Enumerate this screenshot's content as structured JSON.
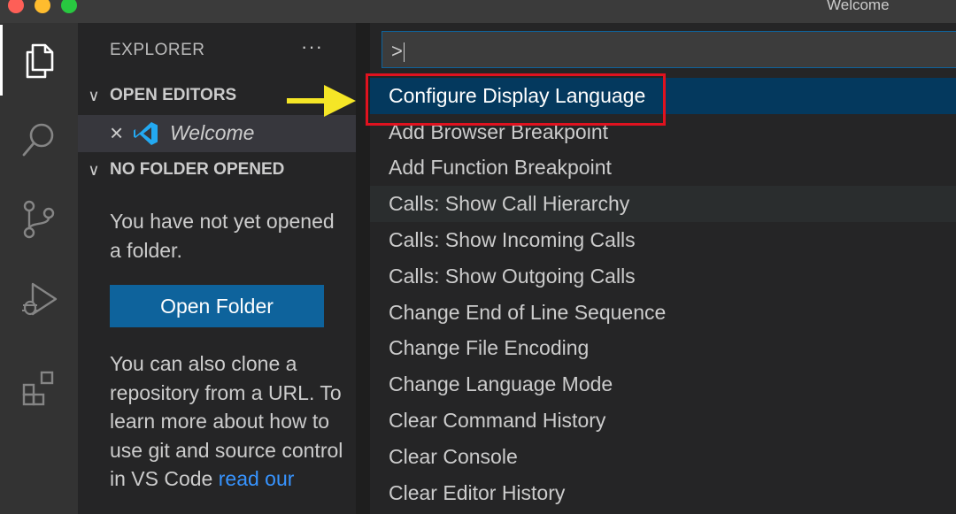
{
  "window": {
    "title": "Welcome"
  },
  "activity_bar": {
    "items": [
      {
        "icon": "explorer-icon",
        "active": true
      },
      {
        "icon": "search-icon",
        "active": false
      },
      {
        "icon": "source-control-icon",
        "active": false
      },
      {
        "icon": "run-debug-icon",
        "active": false
      },
      {
        "icon": "extensions-icon",
        "active": false
      }
    ]
  },
  "sidebar": {
    "title": "EXPLORER",
    "more": "···",
    "open_editors": {
      "header": "OPEN EDITORS",
      "items": [
        {
          "name": "Welcome",
          "icon": "vscode-logo-icon"
        }
      ]
    },
    "no_folder": {
      "header": "NO FOLDER OPENED",
      "message": "You have not yet opened a folder.",
      "button": "Open Folder",
      "clone_text": "You can also clone a repository from a URL. To learn more about how to use git and source control in VS Code ",
      "clone_link": "read our"
    }
  },
  "command_palette": {
    "input_value": ">",
    "items": [
      "Configure Display Language",
      "Add Browser Breakpoint",
      "Add Function Breakpoint",
      "Calls: Show Call Hierarchy",
      "Calls: Show Incoming Calls",
      "Calls: Show Outgoing Calls",
      "Change End of Line Sequence",
      "Change File Encoding",
      "Change Language Mode",
      "Clear Command History",
      "Clear Console",
      "Clear Editor History"
    ],
    "selected_index": 0,
    "hover_index": 3
  },
  "colors": {
    "accent": "#0e639c",
    "selection": "#04395e",
    "highlight_box": "#e0121f",
    "arrow": "#f5e626"
  }
}
